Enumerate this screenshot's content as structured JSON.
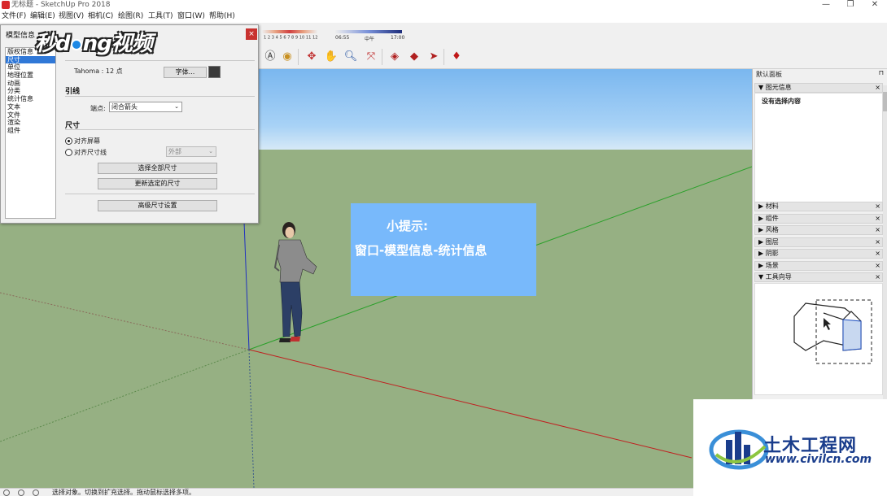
{
  "window": {
    "title": "无标题 - SketchUp Pro 2018",
    "minimize": "—",
    "restore": "❐",
    "close": "✕"
  },
  "menu": [
    "文件(F)",
    "编辑(E)",
    "视图(V)",
    "相机(C)",
    "绘图(R)",
    "工具(T)",
    "窗口(W)",
    "帮助(H)"
  ],
  "shadow_bar": {
    "months": "1 2 3 4 5 6 7 8 9 10 11 12",
    "time_start": "06:55",
    "time_mid": "中午",
    "time_end": "17:00"
  },
  "dialog": {
    "title": "模型信息",
    "close": "×",
    "watermark": "秒懂视频",
    "categories": [
      "版权信息",
      "尺寸",
      "单位",
      "地理位置",
      "动画",
      "分类",
      "统计信息",
      "文本",
      "文件",
      "渲染",
      "组件"
    ],
    "selected_category": "尺寸",
    "font_text": "Tahoma : 12 点",
    "font_button": "字体...",
    "leader_title": "引线",
    "endpoint_label": "端点:",
    "endpoint_value": "闭合箭头",
    "dimension_title": "尺寸",
    "align_screen": "对齐屏幕",
    "align_dimline": "对齐尺寸线",
    "align_dimline_value": "外部",
    "select_all_button": "选择全部尺寸",
    "update_selected_button": "更新选定的尺寸",
    "advanced_button": "高级尺寸设置"
  },
  "tip": {
    "title": "小提示:",
    "body": "窗口-模型信息-统计信息"
  },
  "tray": {
    "title": "默认面板",
    "pin": "⊓",
    "entity_info": "图元信息",
    "no_selection": "没有选择内容",
    "sections": [
      "材料",
      "组件",
      "风格",
      "图层",
      "阴影",
      "场景"
    ],
    "instructor": "工具向导",
    "close": "×"
  },
  "status": {
    "text": "选择对象。切换到扩充选择。拖动鼠标选择多项。"
  },
  "logo": {
    "name": "土木工程网",
    "url": "www.civilcn.com"
  },
  "colors": {
    "sky_top": "#7ab7ef",
    "ground": "#96b083",
    "tip_bg": "#78b9fb",
    "selection": "#3078d7",
    "close_red": "#c8322f",
    "logo_blue": "#1a3d8c"
  }
}
